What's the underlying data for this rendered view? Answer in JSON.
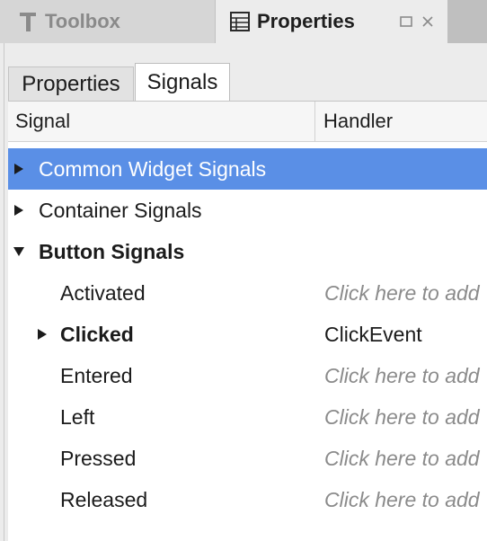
{
  "dock": {
    "toolbox_label": "Toolbox",
    "properties_label": "Properties"
  },
  "tabs": [
    {
      "label": "Properties",
      "active": false
    },
    {
      "label": "Signals",
      "active": true
    }
  ],
  "columns": {
    "signal": "Signal",
    "handler": "Handler"
  },
  "colors": {
    "selection": "#5a8fe6"
  },
  "rows": [
    {
      "label": "Common Widget Signals",
      "handler": "",
      "expander": "collapsed",
      "selected": true
    },
    {
      "label": "Container Signals",
      "handler": "",
      "expander": "collapsed"
    },
    {
      "label": "Button Signals",
      "handler": "",
      "expander": "expanded",
      "bold": true
    },
    {
      "label": "Activated",
      "handler": "Click here to add",
      "placeholder": true
    },
    {
      "label": "Clicked",
      "handler": "ClickEvent",
      "expander": "collapsed",
      "bold": true
    },
    {
      "label": "Entered",
      "handler": "Click here to add",
      "placeholder": true
    },
    {
      "label": "Left",
      "handler": "Click here to add",
      "placeholder": true
    },
    {
      "label": "Pressed",
      "handler": "Click here to add",
      "placeholder": true
    },
    {
      "label": "Released",
      "handler": "Click here to add",
      "placeholder": true
    }
  ]
}
